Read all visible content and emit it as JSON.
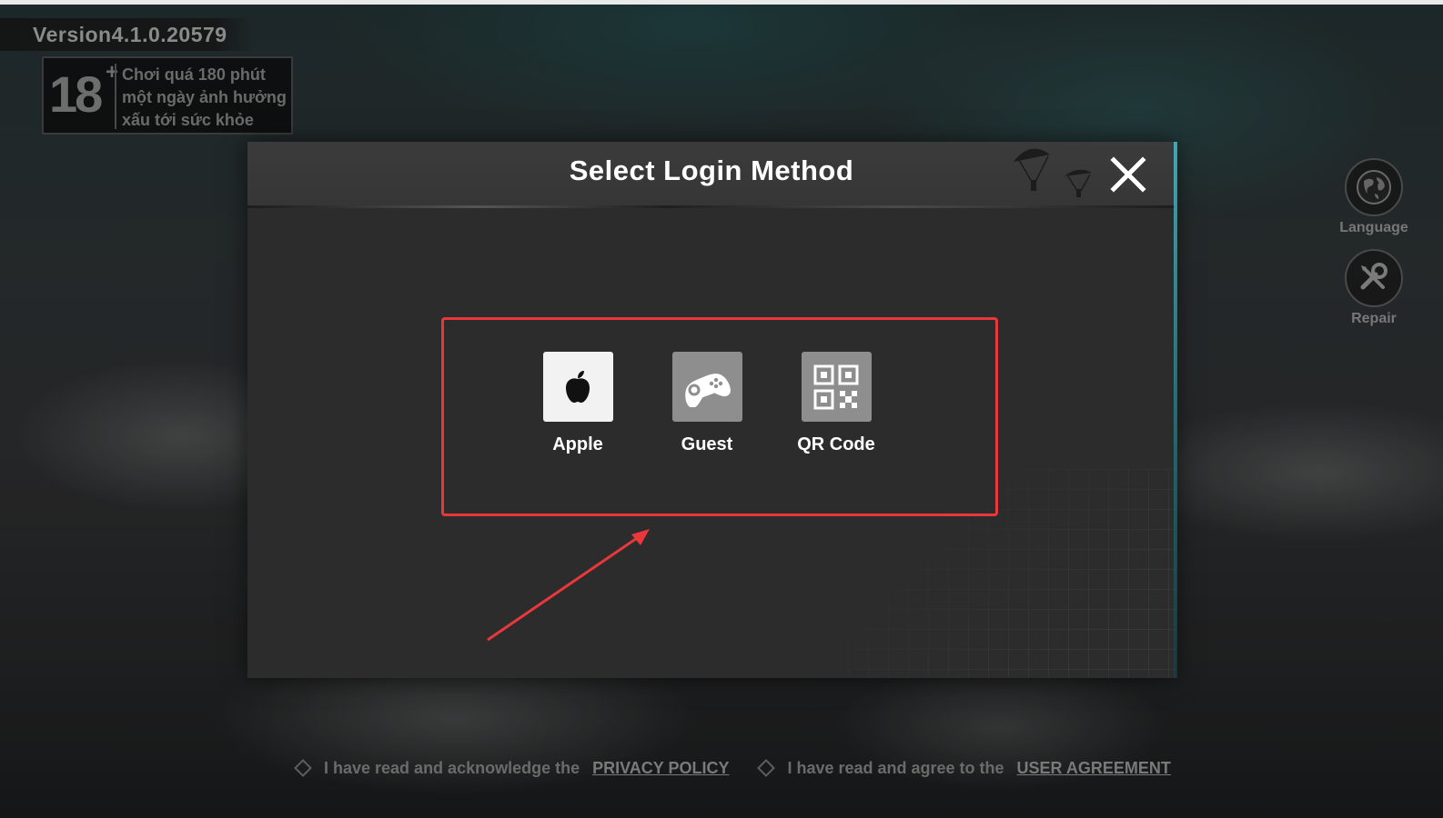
{
  "version": "Version4.1.0.20579",
  "age_notice": {
    "rating": "18",
    "rating_plus": "+",
    "lines": [
      "Chơi quá 180 phút",
      "một ngày ảnh hưởng",
      "xấu tới sức khỏe"
    ]
  },
  "side_menu": {
    "language_label": "Language",
    "repair_label": "Repair"
  },
  "dialog": {
    "title": "Select Login Method",
    "close_icon": "close-icon"
  },
  "login_methods": [
    {
      "label": "Apple",
      "icon": "apple-icon",
      "tile_color": "#f2f2f2"
    },
    {
      "label": "Guest",
      "icon": "gamepad-icon",
      "tile_color": "#8e8e8e"
    },
    {
      "label": "QR Code",
      "icon": "qr-code-icon",
      "tile_color": "#8e8e8e"
    }
  ],
  "footer": {
    "privacy_text": "I have read and acknowledge the",
    "privacy_link": "PRIVACY POLICY",
    "agreement_text": "I have read and agree to the",
    "agreement_link": "USER AGREEMENT"
  },
  "colors": {
    "highlight": "#e8383b",
    "dialog_bg": "#2c2c2c",
    "header_bg": "#3b3b3b"
  }
}
